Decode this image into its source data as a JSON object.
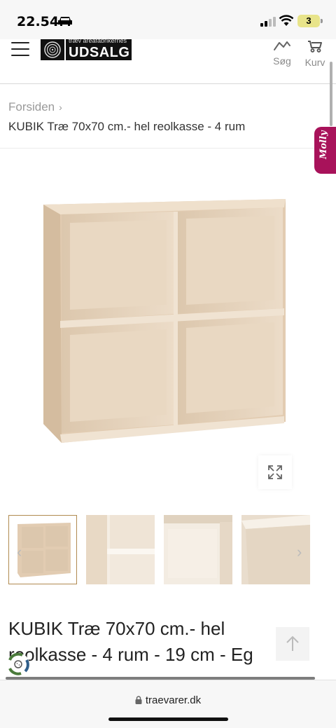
{
  "status_bar": {
    "time": "22.54",
    "battery": "3"
  },
  "header": {
    "logo_small": "træv areafabrikernes",
    "logo_big": "UDSALG",
    "search_label": "Søg",
    "cart_label": "Kurv"
  },
  "breadcrumb": {
    "home": "Forsiden",
    "current": "KUBIK Træ 70x70 cm.- hel reolkasse - 4 rum"
  },
  "chat_tab": {
    "label": "Molly",
    "color": "#a8125a"
  },
  "gallery": {
    "active_thumb": 1,
    "thumb_count": 4
  },
  "product": {
    "title": "KUBIK Træ 70x70 cm.- hel reolkasse - 4 rum - 19 cm - Eg"
  },
  "browser": {
    "url": "traevarer.dk"
  },
  "colors": {
    "wood": "#e6d3bd",
    "accent": "#b08a50"
  }
}
